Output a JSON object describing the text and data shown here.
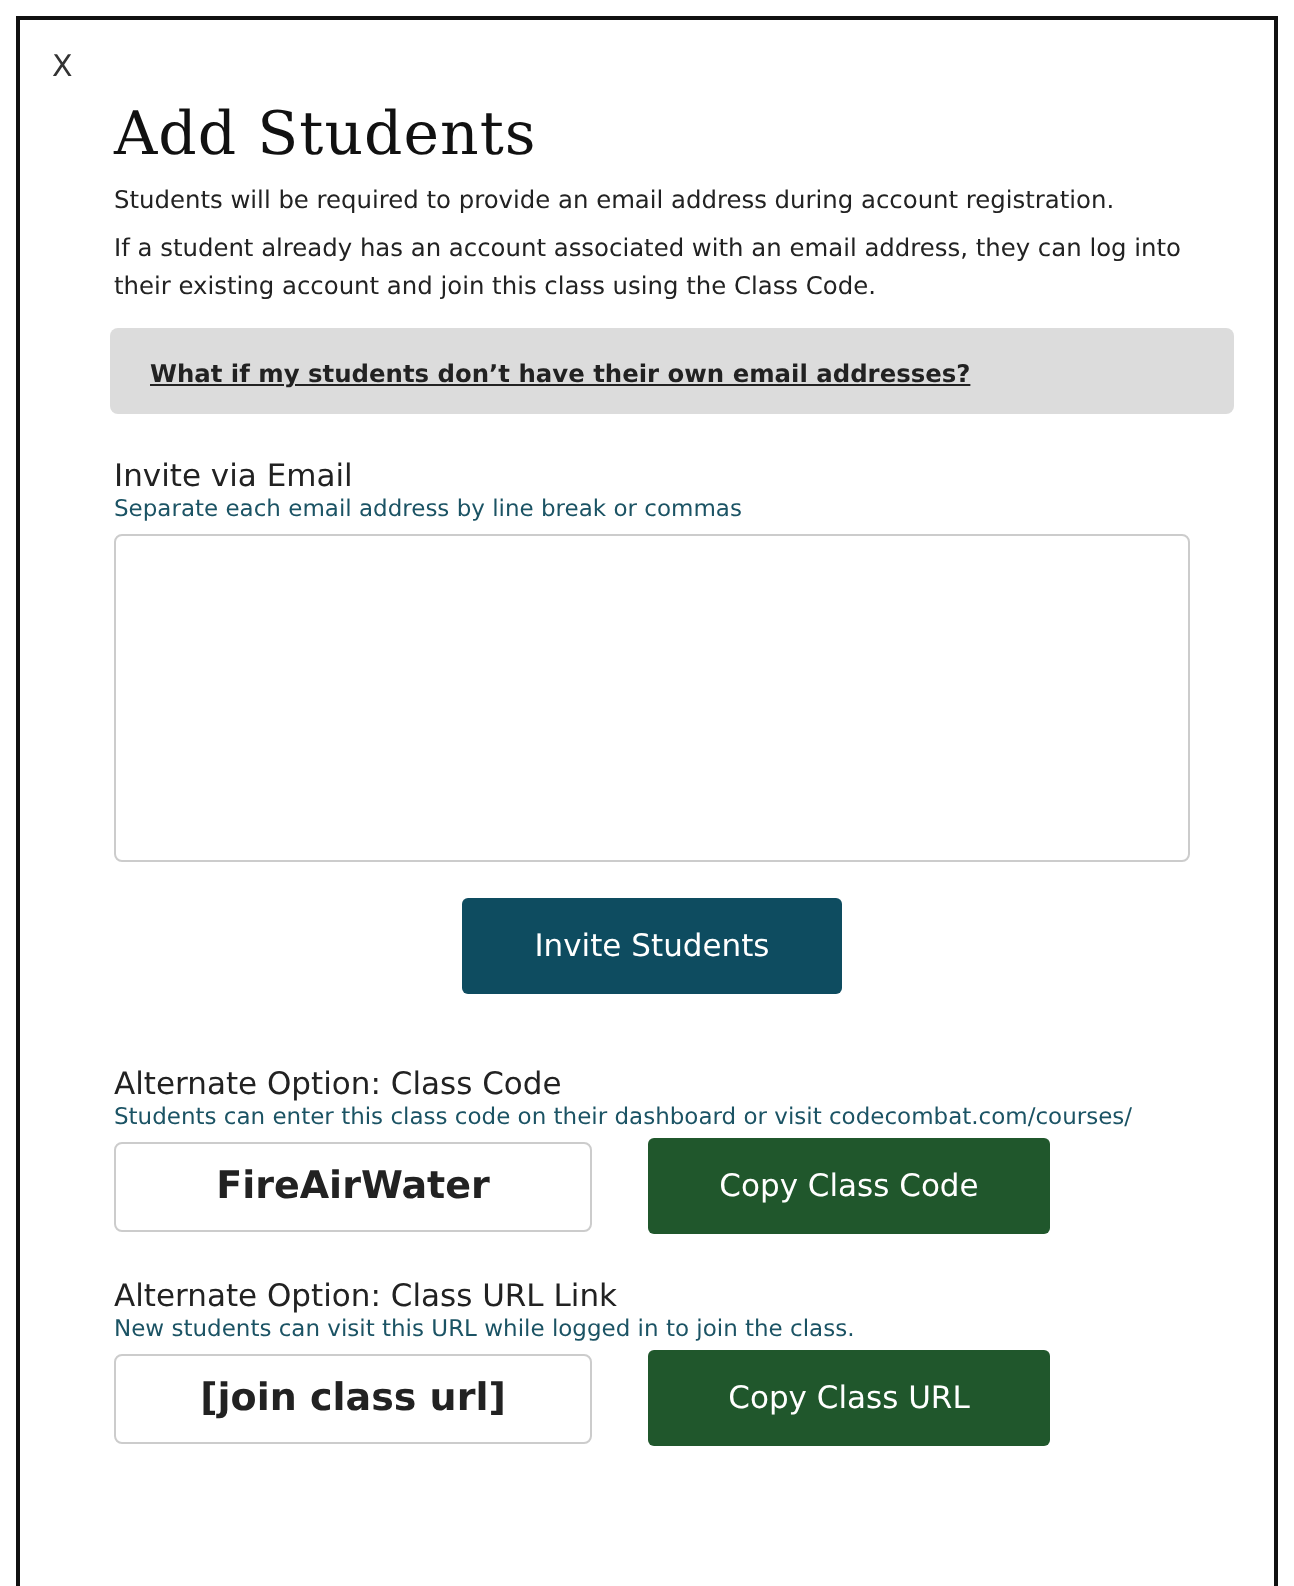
{
  "close": {
    "label": "X"
  },
  "title": "Add Students",
  "intro": [
    "Students will be required to provide an email address during account registration.",
    "If a student already has an account associated with an email address, they can log into their existing account and join this class using the Class Code."
  ],
  "faq_link": "What if my students don’t have their own email addresses?",
  "invite": {
    "label": "Invite via Email",
    "hint": "Separate each email address by line break or commas",
    "button": "Invite Students"
  },
  "options": [
    {
      "label": "Alternate Option: Class Code",
      "hint": "Students can enter this class code on their dashboard or visit codecombat.com/courses/",
      "value": "FireAirWater",
      "button": "Copy Class Code"
    },
    {
      "label": "Alternate Option: Class URL Link",
      "hint": "New students can visit this URL while logged in to join the class.",
      "value": "[join class url]",
      "button": "Copy Class URL"
    }
  ]
}
